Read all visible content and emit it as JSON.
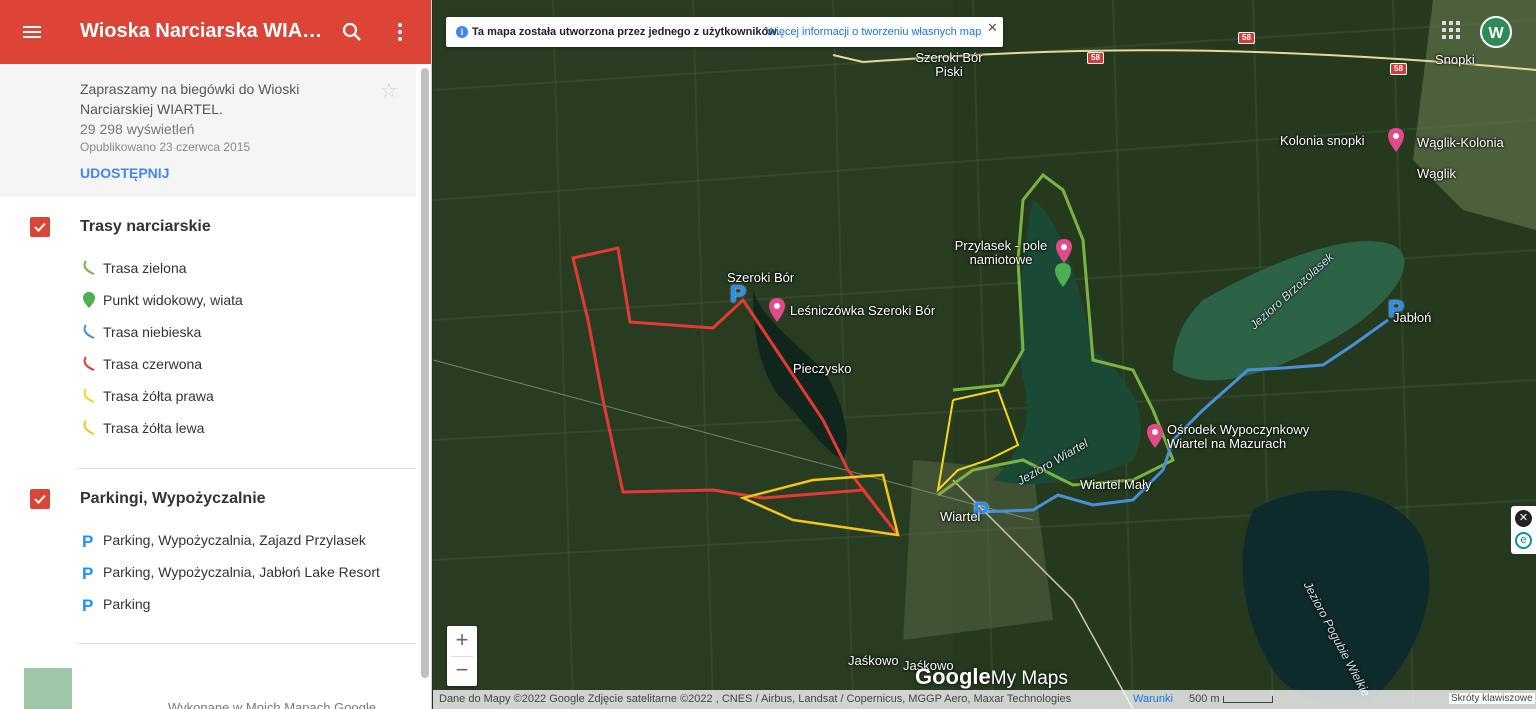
{
  "header": {
    "title": "Wioska Narciarska WIART...",
    "menu_icon": "hamburger-menu-icon",
    "search_icon": "search-icon",
    "more_icon": "more-vert-icon"
  },
  "info": {
    "description": "Zapraszamy na biegówki do Wioski Narciarskiej WIARTEL.",
    "views": "29 298 wyświetleń",
    "published": "Opublikowano 23 czerwca 2015",
    "share_label": "UDOSTĘPNIJ"
  },
  "layers": [
    {
      "title": "Trasy narciarskie",
      "checked": true,
      "items": [
        {
          "label": "Trasa zielona",
          "icon": "route-line-icon",
          "color": "#7cb342"
        },
        {
          "label": "Punkt widokowy, wiata",
          "icon": "map-pin-icon",
          "color": "#4caf50"
        },
        {
          "label": "Trasa niebieska",
          "icon": "route-line-icon",
          "color": "#4a90d9"
        },
        {
          "label": "Trasa czerwona",
          "icon": "route-line-icon",
          "color": "#e53935"
        },
        {
          "label": "Trasa żółta prawa",
          "icon": "route-line-icon",
          "color": "#f9d71c"
        },
        {
          "label": "Trasa żółta lewa",
          "icon": "route-line-icon",
          "color": "#f5c518"
        }
      ]
    },
    {
      "title": "Parkingi, Wypożyczalnie",
      "checked": true,
      "items": [
        {
          "label": "Parking, Wypożyczalnia, Zajazd Przylasek",
          "icon": "parking-icon",
          "color": "#1e90ff"
        },
        {
          "label": "Parking, Wypożyczalnia, Jabłoń Lake Resort",
          "icon": "parking-icon",
          "color": "#1e90ff"
        },
        {
          "label": "Parking",
          "icon": "parking-icon",
          "color": "#1e90ff"
        }
      ]
    }
  ],
  "panel_footer": "Wykonane w Moich Mapach Google",
  "map": {
    "banner_text": "Ta mapa została utworzona przez jednego z użytkowników.",
    "banner_link": "Więcej informacji o tworzeniu własnych map",
    "avatar_letter": "W",
    "road_number": "58",
    "labels": {
      "szeroki_bor_piski": "Szeroki Bór Piski",
      "snopki": "Snopki",
      "kolonia_snopki": "Kolonia snopki",
      "waglik_kolonia": "Wąglik-Kolonia",
      "waglik": "Wąglik",
      "przylasek": "Przylasek - pole namiotowe",
      "szeroki_bor": "Szeroki Bór",
      "lesniczowka": "Leśniczówka Szeroki Bór",
      "pieczysko": "Pieczysko",
      "jezioro_brzozolasek": "Jezioro Brzozolasek",
      "jablon": "Jabłoń",
      "osrodek": "Ośrodek Wypoczynkowy Wiartel na Mazurach",
      "jezioro_wiartel": "Jezioro Wiartel",
      "wiartel_maly": "Wiartel Mały",
      "wiartel": "Wiartel",
      "jaskowo1": "Jaśkowo",
      "jaskowo2": "Jaśkowo",
      "jezioro_pogubie": "Jezioro Pogubie Wielkie"
    },
    "zoom_in": "+",
    "zoom_out": "−",
    "logo_google": "Google",
    "logo_mymaps": "My Maps",
    "attribution": "Dane do Mapy ©2022 Google Zdjęcie satelitarne ©2022 , CNES / Airbus, Landsat / Copernicus, MGGP Aero, Maxar Technologies",
    "terms": "Warunki",
    "scale": "500 m",
    "shortcuts": "Skróty klawiszowe"
  }
}
